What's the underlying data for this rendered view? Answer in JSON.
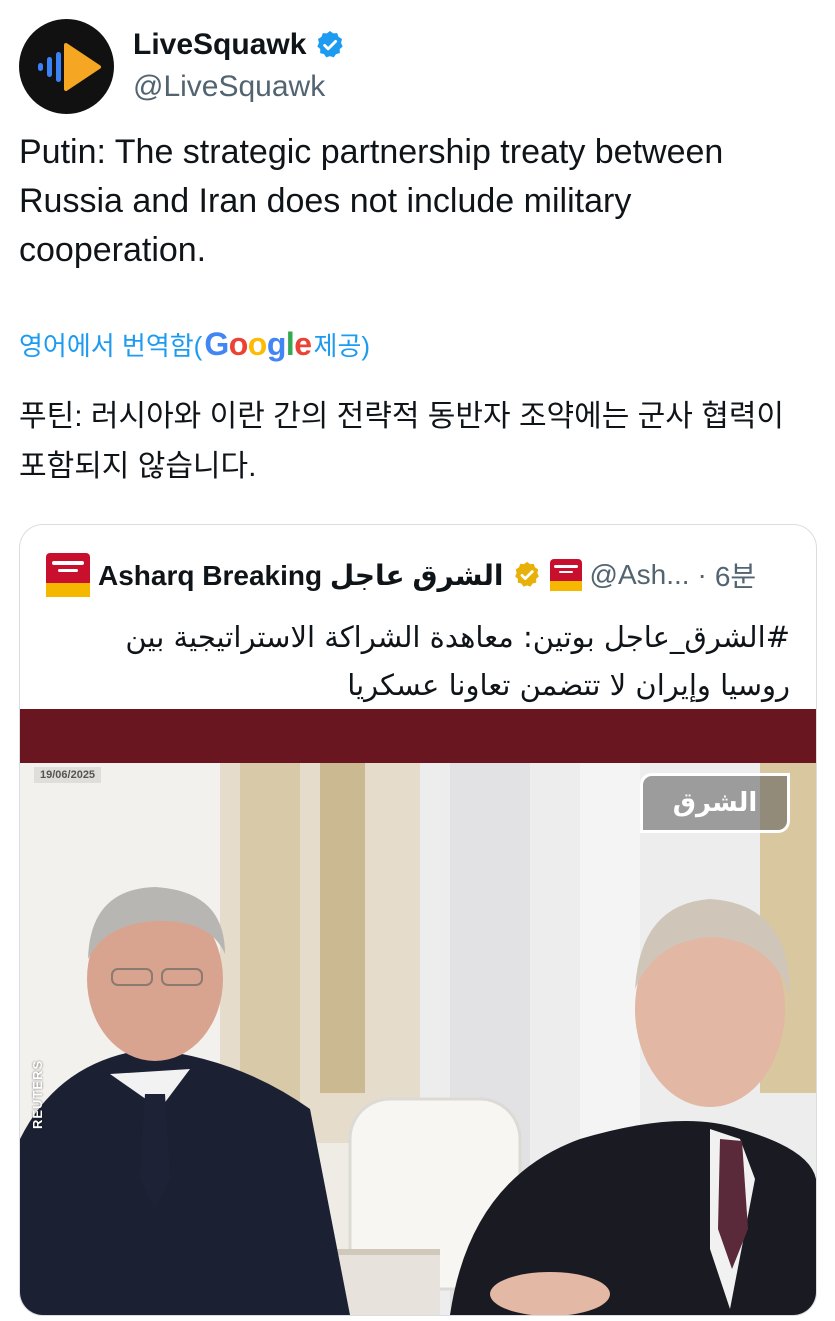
{
  "author": {
    "display_name": "LiveSquawk",
    "handle": "@LiveSquawk",
    "verified": true,
    "avatar_icon": "play-audio-logo-icon"
  },
  "tweet": {
    "text": "Putin: The strategic partnership treaty between Russia and Iran does not include military cooperation."
  },
  "translation": {
    "prefix": "영어에서 번역함(",
    "provider": "Google",
    "suffix": " 제공)",
    "text": "푸틴: 러시아와 이란 간의 전략적 동반자 조약에는 군사 협력이 포함되지 않습니다."
  },
  "quoted_tweet": {
    "display_name": "Asharq Breaking الشرق عاجل",
    "handle": "@Ash...",
    "separator": " · ",
    "time": "6분",
    "text": "#الشرق_عاجل بوتين: معاهدة الشراكة الاستراتيجية بين روسيا وإيران لا تتضمن تعاونا عسكريا",
    "media": {
      "date_stamp": "19/06/2025",
      "channel_logo": "الشرق",
      "credit": "REUTERS"
    }
  },
  "colors": {
    "link_blue": "#1d9bf0",
    "verified_blue": "#1d9bf0",
    "gold_badge": "#e8b10a",
    "brand_red": "#c8102e",
    "brand_yellow": "#f5b700",
    "avatar_orange": "#f5a623"
  }
}
